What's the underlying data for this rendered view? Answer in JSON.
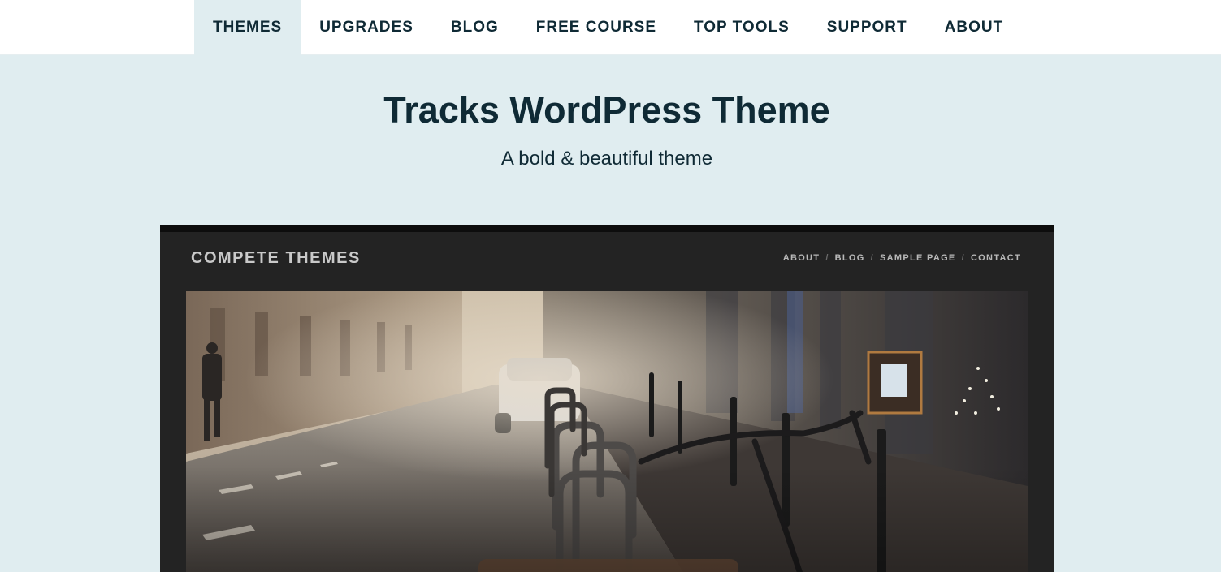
{
  "nav": {
    "items": [
      "THEMES",
      "UPGRADES",
      "BLOG",
      "FREE COURSE",
      "TOP TOOLS",
      "SUPPORT",
      "ABOUT"
    ]
  },
  "hero": {
    "title_bold": "Tracks",
    "title_rest": " WordPress Theme",
    "subtitle": "A bold & beautiful theme"
  },
  "preview": {
    "brand": "COMPETE THEMES",
    "nav": [
      "ABOUT",
      "BLOG",
      "SAMPLE PAGE",
      "CONTACT"
    ],
    "separator": "/",
    "photo_icon": "street-bicycles-photo"
  },
  "colors": {
    "page_bg": "#e0edf0",
    "text": "#0f2a35",
    "nav_bg": "#ffffff",
    "preview_bg": "#232323"
  }
}
